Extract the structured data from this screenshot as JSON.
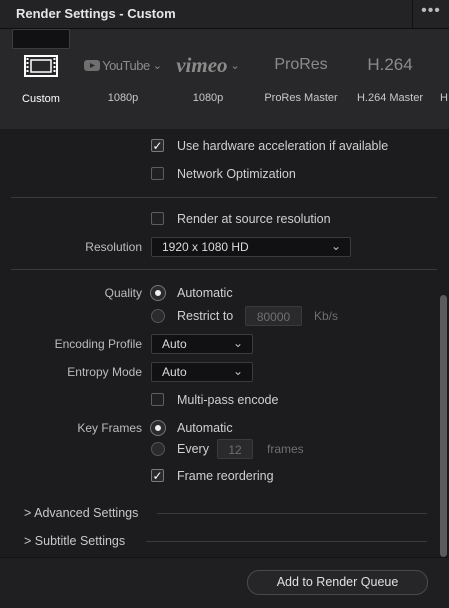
{
  "window": {
    "title": "Render Settings - Custom",
    "more_icon": "more-horizontal-icon"
  },
  "presets": [
    {
      "logo": "film-strip-icon",
      "label": "Custom",
      "selected": true
    },
    {
      "logo": "YouTube",
      "label": "1080p",
      "has_dropdown": true
    },
    {
      "logo": "vimeo",
      "label": "1080p",
      "has_dropdown": true
    },
    {
      "logo": "ProRes",
      "label": "ProRes Master"
    },
    {
      "logo": "H.264",
      "label": "H.264 Master"
    },
    {
      "logo": "",
      "label": "H"
    }
  ],
  "options": {
    "hw_accel": {
      "label": "Use hardware acceleration if available",
      "checked": true
    },
    "network_opt": {
      "label": "Network Optimization",
      "checked": false
    },
    "source_res": {
      "label": "Render at source resolution",
      "checked": false
    },
    "resolution": {
      "label": "Resolution",
      "value": "1920 x 1080 HD"
    },
    "quality": {
      "label": "Quality",
      "automatic": "Automatic",
      "restrict": "Restrict to",
      "restrict_value": "80000",
      "unit": "Kb/s",
      "selected": "automatic"
    },
    "encoding_profile": {
      "label": "Encoding Profile",
      "value": "Auto"
    },
    "entropy_mode": {
      "label": "Entropy Mode",
      "value": "Auto"
    },
    "multipass": {
      "label": "Multi-pass encode",
      "checked": false
    },
    "key_frames": {
      "label": "Key Frames",
      "automatic": "Automatic",
      "every": "Every",
      "every_value": "12",
      "unit": "frames",
      "selected": "automatic"
    },
    "frame_reordering": {
      "label": "Frame reordering",
      "checked": true
    }
  },
  "sections": {
    "advanced": "Advanced Settings",
    "subtitle": "Subtitle Settings"
  },
  "footer": {
    "add_button": "Add to Render Queue"
  }
}
